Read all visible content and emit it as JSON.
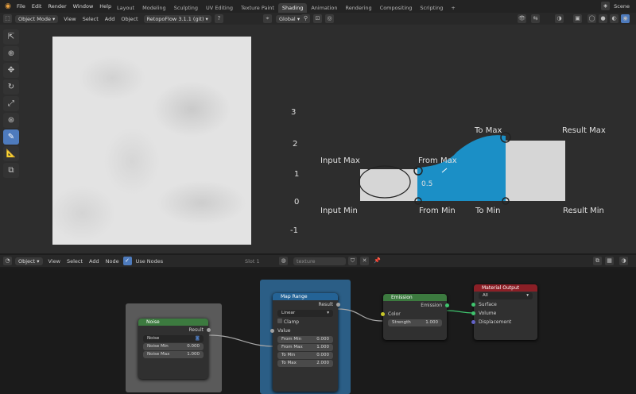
{
  "topbar": {
    "menus": [
      "File",
      "Edit",
      "Render",
      "Window",
      "Help"
    ],
    "tabs": [
      "Layout",
      "Modeling",
      "Sculpting",
      "UV Editing",
      "Texture Paint",
      "Shading",
      "Animation",
      "Rendering",
      "Compositing",
      "Scripting"
    ],
    "active_tab": "Shading",
    "add_tab": "+",
    "scene": "Scene"
  },
  "viewport_header": {
    "mode": "Object Mode",
    "menus": [
      "View",
      "Select",
      "Add",
      "Object"
    ],
    "addon": "RetopoFlow 3.1.1 (git)",
    "transform": "Global"
  },
  "annotations": {
    "input_max": "Input Max",
    "input_min": "Input Min",
    "from_max": "From Max",
    "from_min": "From Min",
    "to_max": "To Max",
    "to_min": "To Min",
    "result_max": "Result Max",
    "result_min": "Result Min",
    "num_3": "3",
    "num_2": "2",
    "num_1": "1",
    "num_0": "0",
    "num_m1": "-1",
    "num_half": "0.5"
  },
  "node_header": {
    "type": "Object",
    "menus": [
      "View",
      "Select",
      "Add",
      "Node"
    ],
    "use_nodes": "Use Nodes",
    "slot": "Slot 1",
    "material": "texture"
  },
  "nodes": {
    "noise": {
      "title": "Noise",
      "output": "Result",
      "type": "Noise",
      "noise_min_label": "Noise Min",
      "noise_min": "0.000",
      "noise_max_label": "Noise Max",
      "noise_max": "1.000"
    },
    "map_range": {
      "title": "Map Range",
      "output": "Result",
      "interp": "Linear",
      "clamp": "Clamp",
      "value": "Value",
      "from_min_label": "From Min",
      "from_min": "0.000",
      "from_max_label": "From Max",
      "from_max": "1.000",
      "to_min_label": "To Min",
      "to_min": "0.000",
      "to_max_label": "To Max",
      "to_max": "2.000"
    },
    "emission": {
      "title": "Emission",
      "output": "Emission",
      "color": "Color",
      "strength_label": "Strength",
      "strength": "1.000"
    },
    "material_output": {
      "title": "Material Output",
      "target": "All",
      "surface": "Surface",
      "volume": "Volume",
      "displacement": "Displacement"
    }
  },
  "colors": {
    "accent_blue": "#4e7bbd",
    "fill_blue": "#1b8fc6",
    "node_green": "#3c7a3f",
    "node_red": "#8b1f26",
    "frame_blue": "#2b5e86"
  }
}
